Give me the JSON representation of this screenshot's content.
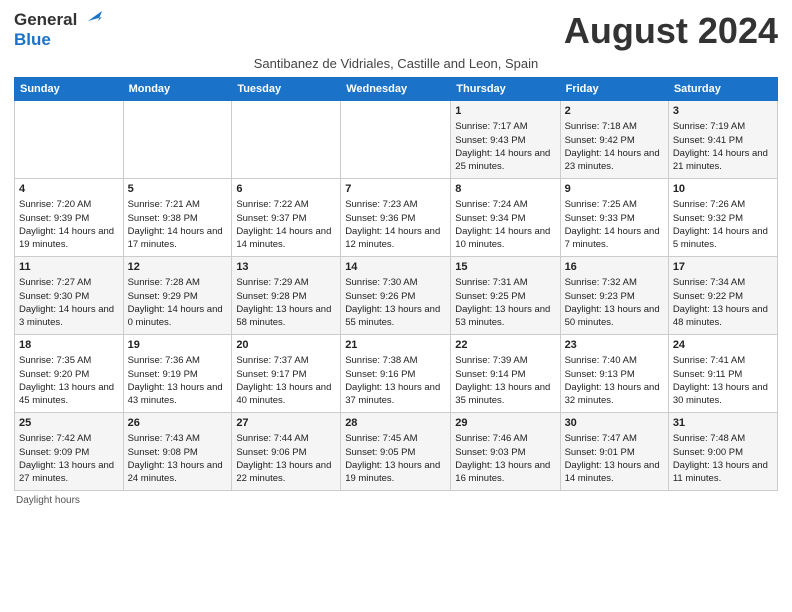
{
  "logo": {
    "line1": "General",
    "line2": "Blue"
  },
  "title": "August 2024",
  "subtitle": "Santibanez de Vidriales, Castille and Leon, Spain",
  "days_header": [
    "Sunday",
    "Monday",
    "Tuesday",
    "Wednesday",
    "Thursday",
    "Friday",
    "Saturday"
  ],
  "weeks": [
    [
      {
        "day": "",
        "info": ""
      },
      {
        "day": "",
        "info": ""
      },
      {
        "day": "",
        "info": ""
      },
      {
        "day": "",
        "info": ""
      },
      {
        "day": "1",
        "info": "Sunrise: 7:17 AM\nSunset: 9:43 PM\nDaylight: 14 hours and 25 minutes."
      },
      {
        "day": "2",
        "info": "Sunrise: 7:18 AM\nSunset: 9:42 PM\nDaylight: 14 hours and 23 minutes."
      },
      {
        "day": "3",
        "info": "Sunrise: 7:19 AM\nSunset: 9:41 PM\nDaylight: 14 hours and 21 minutes."
      }
    ],
    [
      {
        "day": "4",
        "info": "Sunrise: 7:20 AM\nSunset: 9:39 PM\nDaylight: 14 hours and 19 minutes."
      },
      {
        "day": "5",
        "info": "Sunrise: 7:21 AM\nSunset: 9:38 PM\nDaylight: 14 hours and 17 minutes."
      },
      {
        "day": "6",
        "info": "Sunrise: 7:22 AM\nSunset: 9:37 PM\nDaylight: 14 hours and 14 minutes."
      },
      {
        "day": "7",
        "info": "Sunrise: 7:23 AM\nSunset: 9:36 PM\nDaylight: 14 hours and 12 minutes."
      },
      {
        "day": "8",
        "info": "Sunrise: 7:24 AM\nSunset: 9:34 PM\nDaylight: 14 hours and 10 minutes."
      },
      {
        "day": "9",
        "info": "Sunrise: 7:25 AM\nSunset: 9:33 PM\nDaylight: 14 hours and 7 minutes."
      },
      {
        "day": "10",
        "info": "Sunrise: 7:26 AM\nSunset: 9:32 PM\nDaylight: 14 hours and 5 minutes."
      }
    ],
    [
      {
        "day": "11",
        "info": "Sunrise: 7:27 AM\nSunset: 9:30 PM\nDaylight: 14 hours and 3 minutes."
      },
      {
        "day": "12",
        "info": "Sunrise: 7:28 AM\nSunset: 9:29 PM\nDaylight: 14 hours and 0 minutes."
      },
      {
        "day": "13",
        "info": "Sunrise: 7:29 AM\nSunset: 9:28 PM\nDaylight: 13 hours and 58 minutes."
      },
      {
        "day": "14",
        "info": "Sunrise: 7:30 AM\nSunset: 9:26 PM\nDaylight: 13 hours and 55 minutes."
      },
      {
        "day": "15",
        "info": "Sunrise: 7:31 AM\nSunset: 9:25 PM\nDaylight: 13 hours and 53 minutes."
      },
      {
        "day": "16",
        "info": "Sunrise: 7:32 AM\nSunset: 9:23 PM\nDaylight: 13 hours and 50 minutes."
      },
      {
        "day": "17",
        "info": "Sunrise: 7:34 AM\nSunset: 9:22 PM\nDaylight: 13 hours and 48 minutes."
      }
    ],
    [
      {
        "day": "18",
        "info": "Sunrise: 7:35 AM\nSunset: 9:20 PM\nDaylight: 13 hours and 45 minutes."
      },
      {
        "day": "19",
        "info": "Sunrise: 7:36 AM\nSunset: 9:19 PM\nDaylight: 13 hours and 43 minutes."
      },
      {
        "day": "20",
        "info": "Sunrise: 7:37 AM\nSunset: 9:17 PM\nDaylight: 13 hours and 40 minutes."
      },
      {
        "day": "21",
        "info": "Sunrise: 7:38 AM\nSunset: 9:16 PM\nDaylight: 13 hours and 37 minutes."
      },
      {
        "day": "22",
        "info": "Sunrise: 7:39 AM\nSunset: 9:14 PM\nDaylight: 13 hours and 35 minutes."
      },
      {
        "day": "23",
        "info": "Sunrise: 7:40 AM\nSunset: 9:13 PM\nDaylight: 13 hours and 32 minutes."
      },
      {
        "day": "24",
        "info": "Sunrise: 7:41 AM\nSunset: 9:11 PM\nDaylight: 13 hours and 30 minutes."
      }
    ],
    [
      {
        "day": "25",
        "info": "Sunrise: 7:42 AM\nSunset: 9:09 PM\nDaylight: 13 hours and 27 minutes."
      },
      {
        "day": "26",
        "info": "Sunrise: 7:43 AM\nSunset: 9:08 PM\nDaylight: 13 hours and 24 minutes."
      },
      {
        "day": "27",
        "info": "Sunrise: 7:44 AM\nSunset: 9:06 PM\nDaylight: 13 hours and 22 minutes."
      },
      {
        "day": "28",
        "info": "Sunrise: 7:45 AM\nSunset: 9:05 PM\nDaylight: 13 hours and 19 minutes."
      },
      {
        "day": "29",
        "info": "Sunrise: 7:46 AM\nSunset: 9:03 PM\nDaylight: 13 hours and 16 minutes."
      },
      {
        "day": "30",
        "info": "Sunrise: 7:47 AM\nSunset: 9:01 PM\nDaylight: 13 hours and 14 minutes."
      },
      {
        "day": "31",
        "info": "Sunrise: 7:48 AM\nSunset: 9:00 PM\nDaylight: 13 hours and 11 minutes."
      }
    ]
  ],
  "footer": "Daylight hours"
}
